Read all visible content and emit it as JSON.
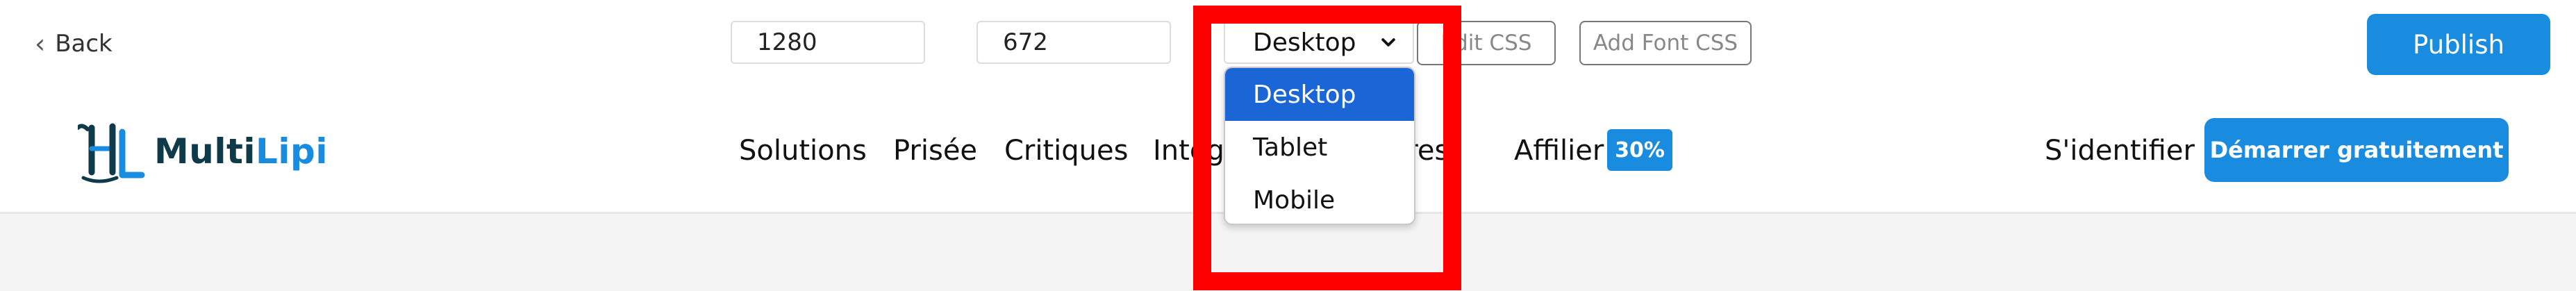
{
  "toolbar": {
    "back_label": "Back",
    "width_value": "1280",
    "height_value": "672",
    "device_selected": "Desktop",
    "edit_css_label": "Edit CSS",
    "add_font_css_label": "Add Font CSS",
    "publish_label": "Publish"
  },
  "device_dropdown": {
    "options": [
      {
        "label": "Desktop",
        "selected": true
      },
      {
        "label": "Tablet",
        "selected": false
      },
      {
        "label": "Mobile",
        "selected": false
      }
    ]
  },
  "site": {
    "logo": {
      "text_main": "Multi",
      "text_accent": "Lipi"
    },
    "nav": {
      "solutions": "Solutions",
      "prisee": "Prisée",
      "critiques": "Critiques",
      "integ_partial": "Integ",
      "ures_partial": "ures",
      "affilier": "Affilier",
      "affilier_badge": "30%",
      "login": "S'identifier",
      "cta": "Démarrer gratuitement"
    }
  },
  "colors": {
    "accent": "#1a8ce0",
    "highlight": "#ff0000",
    "selected_option": "#1a66d6",
    "logo_dark": "#0e3a4a"
  }
}
